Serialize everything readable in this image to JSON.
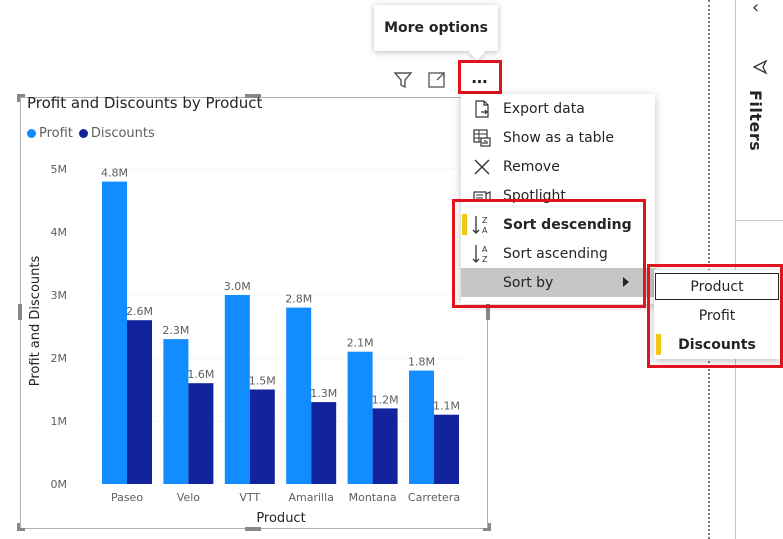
{
  "tooltip": {
    "text": "More options"
  },
  "visual_header": {
    "more_label": "…"
  },
  "menu": {
    "items": [
      {
        "label": "Export data",
        "icon": "export-icon"
      },
      {
        "label": "Show as a table",
        "icon": "table-icon"
      },
      {
        "label": "Remove",
        "icon": "close-icon"
      },
      {
        "label": "Spotlight",
        "icon": "spotlight-icon"
      },
      {
        "label": "Sort descending",
        "icon": "sort-descending-icon",
        "active": true
      },
      {
        "label": "Sort ascending",
        "icon": "sort-ascending-icon"
      },
      {
        "label": "Sort by",
        "icon": "",
        "has_submenu": true,
        "selected": true
      }
    ]
  },
  "submenu": {
    "items": [
      {
        "label": "Product",
        "focused": true
      },
      {
        "label": "Profit"
      },
      {
        "label": "Discounts",
        "active": true
      }
    ]
  },
  "filters_pane": {
    "label": "Filters"
  },
  "colors": {
    "profit": "#118dff",
    "discounts": "#12239e",
    "accent_marker": "#f2c811",
    "highlight_red": "#e1141e"
  },
  "chart_data": {
    "type": "bar",
    "title": "Profit and Discounts by Product",
    "xlabel": "Product",
    "ylabel": "Profit and Discounts",
    "categories": [
      "Paseo",
      "Velo",
      "VTT",
      "Amarilla",
      "Montana",
      "Carretera"
    ],
    "series": [
      {
        "name": "Profit",
        "values": [
          4.8,
          2.3,
          3.0,
          2.8,
          2.1,
          1.8
        ],
        "labels": [
          "4.8M",
          "2.3M",
          "3.0M",
          "2.8M",
          "2.1M",
          "1.8M"
        ]
      },
      {
        "name": "Discounts",
        "values": [
          2.6,
          1.6,
          1.5,
          1.3,
          1.2,
          1.1
        ],
        "labels": [
          "2.6M",
          "1.6M",
          "1.5M",
          "1.3M",
          "1.2M",
          "1.1M"
        ]
      }
    ],
    "ylim": [
      0,
      5
    ],
    "yticks": [
      "0M",
      "1M",
      "2M",
      "3M",
      "4M",
      "5M"
    ],
    "grid": true,
    "legend_position": "top-left"
  }
}
